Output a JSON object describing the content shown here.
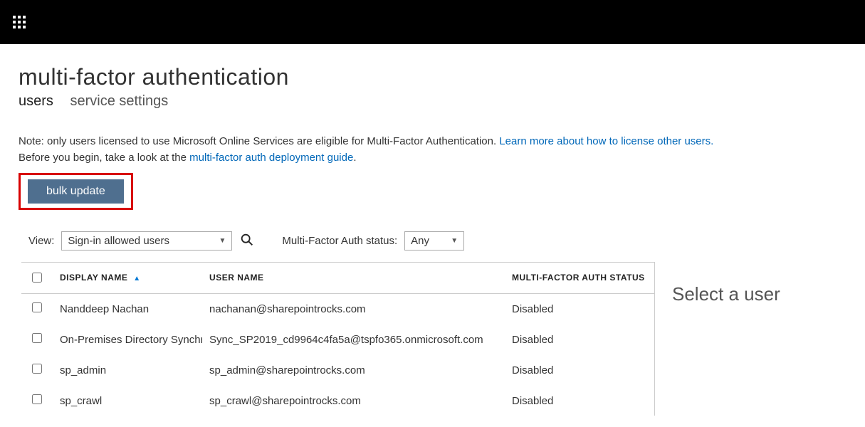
{
  "page_title": "multi-factor authentication",
  "tabs": {
    "users": "users",
    "service_settings": "service settings"
  },
  "note": {
    "line1a": "Note: only users licensed to use Microsoft Online Services are eligible for Multi-Factor Authentication. ",
    "link1": "Learn more about how to license other users.",
    "line2a": "Before you begin, take a look at the ",
    "link2": "multi-factor auth deployment guide",
    "line2b": "."
  },
  "bulk_update_label": "bulk update",
  "filters": {
    "view_label": "View:",
    "view_value": "Sign-in allowed users",
    "status_label": "Multi-Factor Auth status:",
    "status_value": "Any"
  },
  "columns": {
    "display_name": "DISPLAY NAME",
    "user_name": "USER NAME",
    "status": "MULTI-FACTOR AUTH STATUS"
  },
  "users": [
    {
      "display_name": "Nanddeep Nachan",
      "user_name": "nachanan@sharepointrocks.com",
      "status": "Disabled"
    },
    {
      "display_name": "On-Premises Directory Synchronization",
      "user_name": "Sync_SP2019_cd9964c4fa5a@tspfo365.onmicrosoft.com",
      "status": "Disabled"
    },
    {
      "display_name": "sp_admin",
      "user_name": "sp_admin@sharepointrocks.com",
      "status": "Disabled"
    },
    {
      "display_name": "sp_crawl",
      "user_name": "sp_crawl@sharepointrocks.com",
      "status": "Disabled"
    }
  ],
  "side_panel": {
    "heading": "Select a user"
  }
}
